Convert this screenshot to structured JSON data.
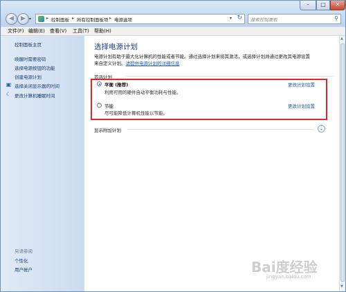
{
  "window": {
    "controls": {
      "minimize": "–",
      "maximize": "□",
      "close": "✕"
    }
  },
  "address_bar": {
    "crumbs": [
      "控制面板",
      "所有控制面板项",
      "电源选项"
    ],
    "separator": "▸",
    "dropdown": "▾",
    "refresh": "↻"
  },
  "search": {
    "placeholder": "搜索控制面板",
    "icon": "search-icon"
  },
  "menubar": {
    "items": [
      "文件(F)",
      "编辑(E)",
      "查看(V)",
      "工具(T)",
      "帮助(H)"
    ]
  },
  "sidebar": {
    "home": "控制面板主页",
    "links": [
      "唤醒时需要密码",
      "选择电源按钮的功能",
      "创建电源计划",
      "选择关闭显示器的时间",
      "更改计算机睡眠时间"
    ],
    "see_also": "另请参阅",
    "see_also_links": [
      "个性化",
      "用户帐户"
    ]
  },
  "main": {
    "title": "选择电源计划",
    "description_line1": "电源计划有助于最大化计算机的性能或者节能。通过选择计划来将其激活，或选择计划并通过更改其电源设置",
    "description_line2_prefix": "来自定义计划。",
    "description_link": "请提供电源计划的详细信息",
    "preferred_label": "首选计划",
    "plans": [
      {
        "name": "平衡 (推荐)",
        "description": "利用可用的硬件自动平衡功耗与性能。",
        "link": "更改计划设置",
        "selected": true
      },
      {
        "name": "节能",
        "description": "尽可能降低计算机性能以节能。",
        "link": "更改计划设置",
        "selected": false
      }
    ],
    "more_plans_label": "显示附加计划",
    "expand_glyph": "⌄"
  },
  "watermark": {
    "logo": "Bai度经验",
    "url": "jingyan.baidu.com"
  }
}
